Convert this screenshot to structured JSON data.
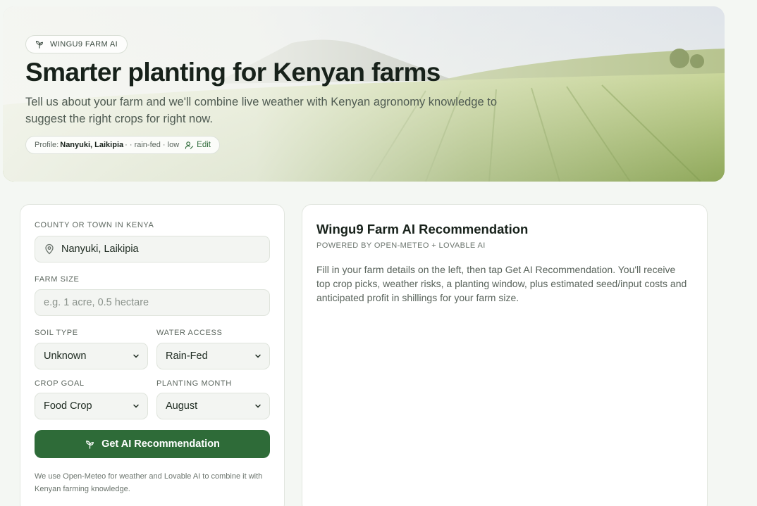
{
  "hero": {
    "badge": "WINGU9 FARM AI",
    "title": "Smarter planting for Kenyan farms",
    "subtitle": "Tell us about your farm and we'll combine live weather with Kenyan agronomy knowledge to suggest the right crops for right now.",
    "profile": {
      "prefix": "Profile:",
      "location": "Nanyuki, Laikipia",
      "details": "· · rain-fed · low",
      "edit_label": "Edit"
    }
  },
  "form": {
    "location_label": "COUNTY OR TOWN IN KENYA",
    "location_value": "Nanyuki, Laikipia",
    "farm_size_label": "FARM SIZE",
    "farm_size_placeholder": "e.g. 1 acre, 0.5 hectare",
    "soil_label": "SOIL TYPE",
    "soil_value": "Unknown",
    "water_label": "WATER ACCESS",
    "water_value": "Rain-Fed",
    "goal_label": "CROP GOAL",
    "goal_value": "Food Crop",
    "month_label": "PLANTING MONTH",
    "month_value": "August",
    "submit_label": "Get AI Recommendation",
    "note": "We use Open-Meteo for weather and Lovable AI to combine it with Kenyan farming knowledge."
  },
  "result": {
    "title": "Wingu9 Farm AI Recommendation",
    "powered_by": "POWERED BY OPEN-METEO + LOVABLE AI",
    "body": "Fill in your farm details on the left, then tap Get AI Recommendation. You'll receive top crop picks, weather risks, a planting window, plus estimated seed/input costs and anticipated profit in shillings for your farm size."
  },
  "colors": {
    "accent": "#2e6b38",
    "background": "#f4f7f3",
    "card": "#ffffff"
  },
  "icons": {
    "badge": "sprout-icon",
    "edit": "user-edit-icon",
    "location": "map-pin-icon",
    "select": "chevron-down-icon",
    "submit": "sprout-icon"
  }
}
